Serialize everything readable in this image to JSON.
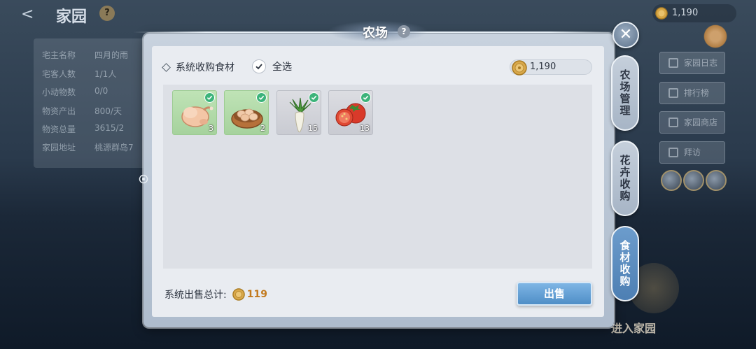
{
  "background": {
    "title": "家园",
    "help": "?",
    "coins": "1,190",
    "info_rows": [
      {
        "key": "宅主名称",
        "value": "四月的雨"
      },
      {
        "key": "宅客人数",
        "value": "1/1人"
      },
      {
        "key": "小动物数",
        "value": "0/0"
      },
      {
        "key": "物资产出",
        "value": "800/天"
      },
      {
        "key": "物资总量",
        "value": "3615/2"
      },
      {
        "key": "家园地址",
        "value": "桃源群岛7"
      }
    ],
    "right_buttons": [
      "家园日志",
      "排行榜",
      "家园商店",
      "拜访"
    ],
    "enter_label": "进入家园"
  },
  "modal": {
    "title": "农场",
    "help": "?",
    "close": "✕",
    "section_label": "系统收购食材",
    "select_all": "全选",
    "coins": "1,190",
    "items": [
      {
        "name": "chicken",
        "qty": "3",
        "bg": "green"
      },
      {
        "name": "eggs",
        "qty": "2",
        "bg": "green"
      },
      {
        "name": "radish",
        "qty": "15",
        "bg": "gray"
      },
      {
        "name": "tomato",
        "qty": "13",
        "bg": "gray"
      }
    ],
    "total_label": "系统出售总计:",
    "total_value": "119",
    "sell_button": "出售"
  },
  "side_tabs": [
    {
      "label": "农场管理",
      "active": false
    },
    {
      "label": "花卉收购",
      "active": false
    },
    {
      "label": "食材收购",
      "active": true
    }
  ],
  "colors": {
    "accent_blue": "#4f8ec7",
    "check_green": "#3cb37a",
    "total_orange": "#c27a1e"
  }
}
